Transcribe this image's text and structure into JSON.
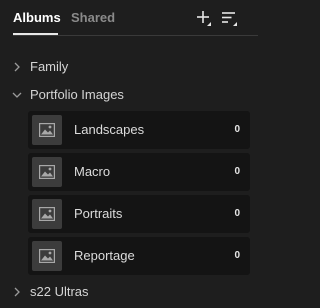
{
  "tabs": [
    {
      "label": "Albums",
      "active": true
    },
    {
      "label": "Shared",
      "active": false
    }
  ],
  "header_actions": {
    "add_icon": "plus-icon",
    "sort_icon": "sort-lines-icon"
  },
  "tree": {
    "family": {
      "label": "Family",
      "expanded": false
    },
    "portfolio": {
      "label": "Portfolio Images",
      "expanded": true,
      "albums": [
        {
          "name": "Landscapes",
          "count": "0"
        },
        {
          "name": "Macro",
          "count": "0"
        },
        {
          "name": "Portraits",
          "count": "0"
        },
        {
          "name": "Reportage",
          "count": "0"
        }
      ]
    },
    "s22": {
      "label": "s22 Ultras",
      "expanded": false
    }
  },
  "colors": {
    "background": "#1e1e1e",
    "card": "#141414",
    "thumb": "#3c3c3c",
    "active_tab": "#ffffff",
    "inactive_tab": "#8a8a8a"
  }
}
